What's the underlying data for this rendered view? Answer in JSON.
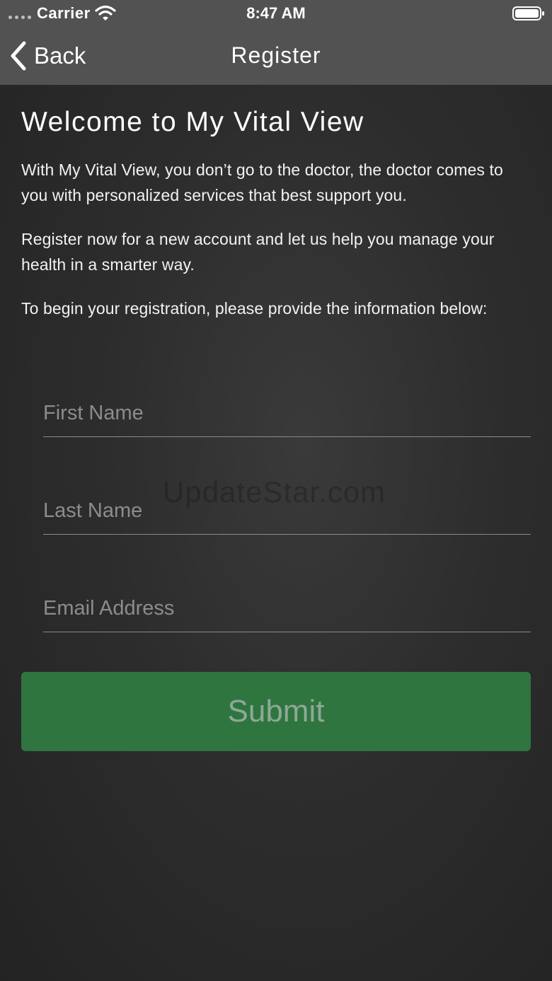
{
  "status_bar": {
    "carrier": "Carrier",
    "time": "8:47 AM",
    "signal_icon": "signal-dots-icon",
    "wifi_icon": "wifi-icon",
    "battery_icon": "battery-icon"
  },
  "nav": {
    "back_label": "Back",
    "back_icon": "chevron-left-icon",
    "title": "Register"
  },
  "content": {
    "welcome_title": "Welcome to My Vital View",
    "paragraph_1": "With My Vital View, you don’t go to the doctor, the doctor comes to you with personalized services that best support you.",
    "paragraph_2": "Register now for a new account and let us help you manage your health in a smarter way.",
    "paragraph_3": "To begin your registration, please provide the information below:"
  },
  "form": {
    "first_name": {
      "placeholder": "First Name",
      "value": ""
    },
    "last_name": {
      "placeholder": "Last Name",
      "value": ""
    },
    "email": {
      "placeholder": "Email Address",
      "value": ""
    },
    "submit_label": "Submit"
  },
  "watermark": "UpdateStar.com",
  "colors": {
    "header_bg": "#525252",
    "background": "#2d2d2d",
    "submit_bg": "#2f7540",
    "submit_text": "#8fa896"
  }
}
